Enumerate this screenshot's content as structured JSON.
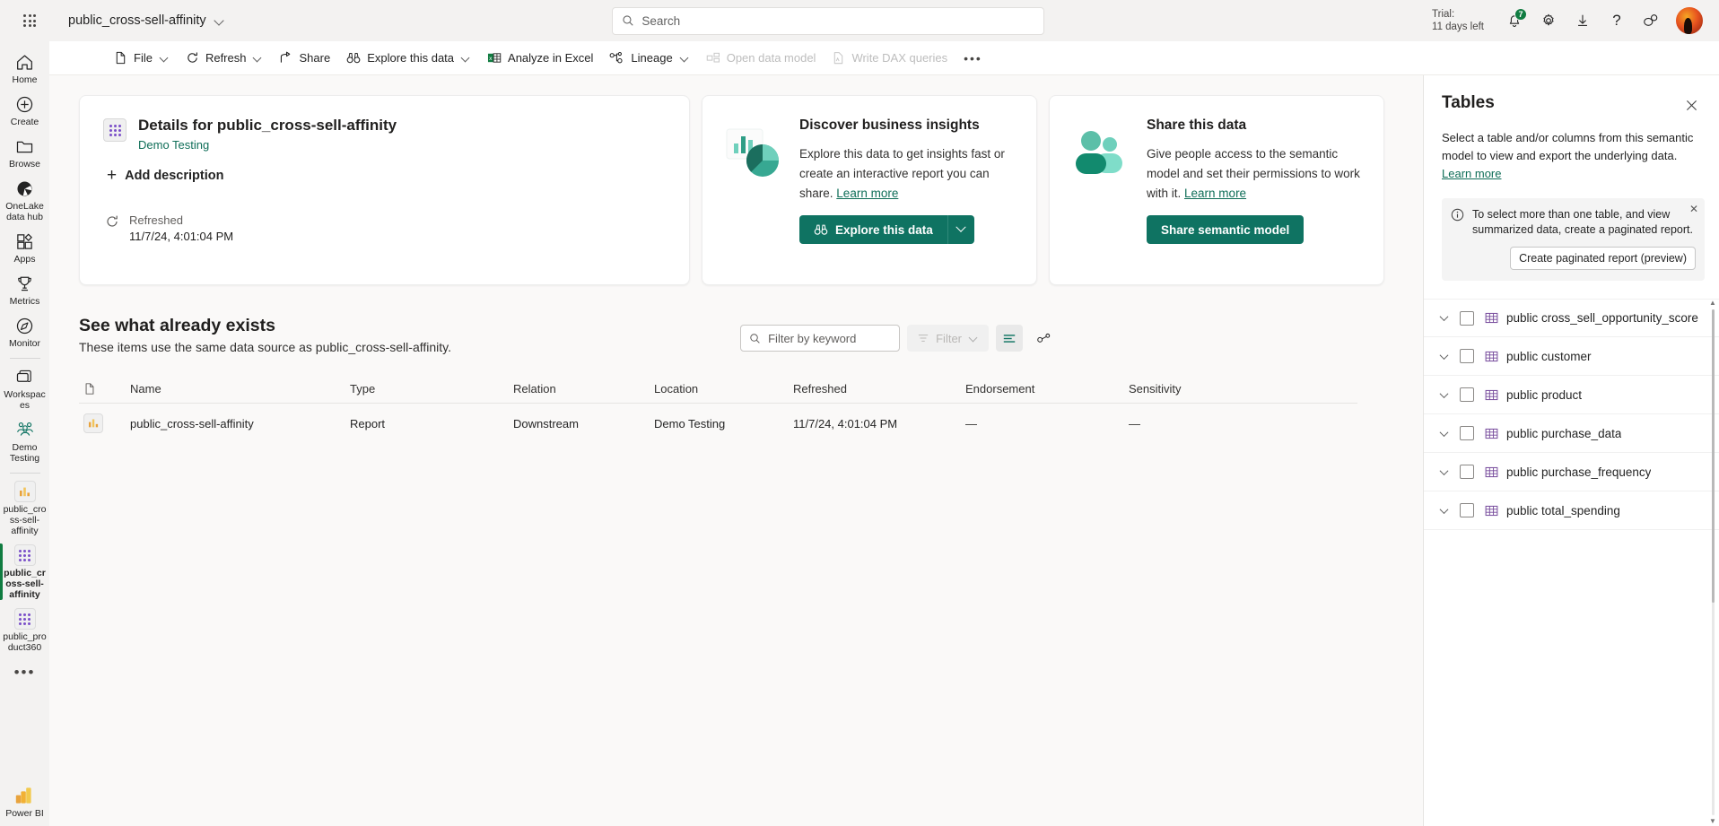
{
  "topbar": {
    "waffle_label": "app-launcher",
    "app_title": "public_cross-sell-affinity",
    "search_placeholder": "Search",
    "trial_line1": "Trial:",
    "trial_line2": "11 days left",
    "notification_count": "7",
    "settings_label": "Settings",
    "download_label": "Downloads",
    "help_label": "Help",
    "feedback_label": "Feedback",
    "account_label": "Account manager"
  },
  "commandbar": {
    "items": [
      {
        "label": "File",
        "icon": "file-icon",
        "caret": true,
        "disabled": false
      },
      {
        "label": "Refresh",
        "icon": "refresh-icon",
        "caret": true,
        "disabled": false
      },
      {
        "label": "Share",
        "icon": "share-icon",
        "caret": false,
        "disabled": false
      },
      {
        "label": "Explore this data",
        "icon": "binoculars-icon",
        "caret": true,
        "disabled": false
      },
      {
        "label": "Analyze in Excel",
        "icon": "excel-icon",
        "caret": false,
        "disabled": false
      },
      {
        "label": "Lineage",
        "icon": "lineage-icon",
        "caret": true,
        "disabled": false
      },
      {
        "label": "Open data model",
        "icon": "model-icon",
        "caret": false,
        "disabled": true
      },
      {
        "label": "Write DAX queries",
        "icon": "dax-icon",
        "caret": false,
        "disabled": true
      }
    ],
    "overflow_label": "•••"
  },
  "rail": {
    "items": [
      {
        "label": "Home",
        "icon": "home-icon",
        "active": false
      },
      {
        "label": "Create",
        "icon": "plus-circle-icon",
        "active": false
      },
      {
        "label": "Browse",
        "icon": "folder-icon",
        "active": false
      },
      {
        "label": "OneLake data hub",
        "icon": "onelake-icon",
        "active": false
      },
      {
        "label": "Apps",
        "icon": "apps-icon",
        "active": false
      },
      {
        "label": "Metrics",
        "icon": "trophy-icon",
        "active": false
      },
      {
        "label": "Monitor",
        "icon": "compass-icon",
        "active": false
      },
      {
        "label": "Workspaces",
        "icon": "workspaces-icon",
        "active": false
      },
      {
        "label": "Demo Testing",
        "icon": "group-icon",
        "active": false
      }
    ],
    "pinned": [
      {
        "label": "public_cross-sell-affinity",
        "icon": "report-icon",
        "active": false
      },
      {
        "label": "public_cross-sell-affinity",
        "icon": "semantic-model-icon",
        "active": true
      },
      {
        "label": "public_product360",
        "icon": "semantic-model-icon",
        "active": false
      }
    ],
    "more_label": "•••",
    "brand_label": "Power BI"
  },
  "details_card": {
    "title": "Details for public_cross-sell-affinity",
    "workspace": "Demo Testing",
    "add_description": "Add description",
    "refreshed_label": "Refreshed",
    "refreshed_value": "11/7/24, 4:01:04 PM"
  },
  "insights_card": {
    "heading": "Discover business insights",
    "body": "Explore this data to get insights fast or create an interactive report you can share.",
    "learn_more": "Learn more",
    "button": "Explore this data"
  },
  "share_card": {
    "heading": "Share this data",
    "body": "Give people access to the semantic model and set their permissions to work with it.",
    "learn_more": "Learn more",
    "button": "Share semantic model"
  },
  "exists_section": {
    "heading": "See what already exists",
    "subtext": "These items use the same data source as public_cross-sell-affinity.",
    "keyword_placeholder": "Filter by keyword",
    "filter_label": "Filter",
    "view_label": "View",
    "lineage_label": "Lineage view"
  },
  "table": {
    "columns": [
      "",
      "Name",
      "Type",
      "Relation",
      "Location",
      "Refreshed",
      "Endorsement",
      "Sensitivity"
    ],
    "rows": [
      {
        "icon": "report-icon",
        "name": "public_cross-sell-affinity",
        "type": "Report",
        "relation": "Downstream",
        "location": "Demo Testing",
        "refreshed": "11/7/24, 4:01:04 PM",
        "endorsement": "—",
        "sensitivity": "—"
      }
    ]
  },
  "tables_panel": {
    "title": "Tables",
    "close_label": "Close",
    "description": "Select a table and/or columns from this semantic model to view and export the underlying data.",
    "learn_more": "Learn more",
    "note": "To select more than one table, and view summarized data, create a paginated report.",
    "note_close_label": "Dismiss",
    "paginated_button": "Create paginated report (preview)",
    "tables": [
      {
        "label": "public cross_sell_opportunity_score",
        "checked": false
      },
      {
        "label": "public customer",
        "checked": false
      },
      {
        "label": "public product",
        "checked": false
      },
      {
        "label": "public purchase_data",
        "checked": false
      },
      {
        "label": "public purchase_frequency",
        "checked": false
      },
      {
        "label": "public total_spending",
        "checked": false
      }
    ]
  },
  "colors": {
    "accent_green": "#0f7362",
    "link_green": "#0f6e58",
    "badge_green": "#107c41",
    "canvas": "#faf9f8",
    "chrome": "#f3f2f1"
  }
}
